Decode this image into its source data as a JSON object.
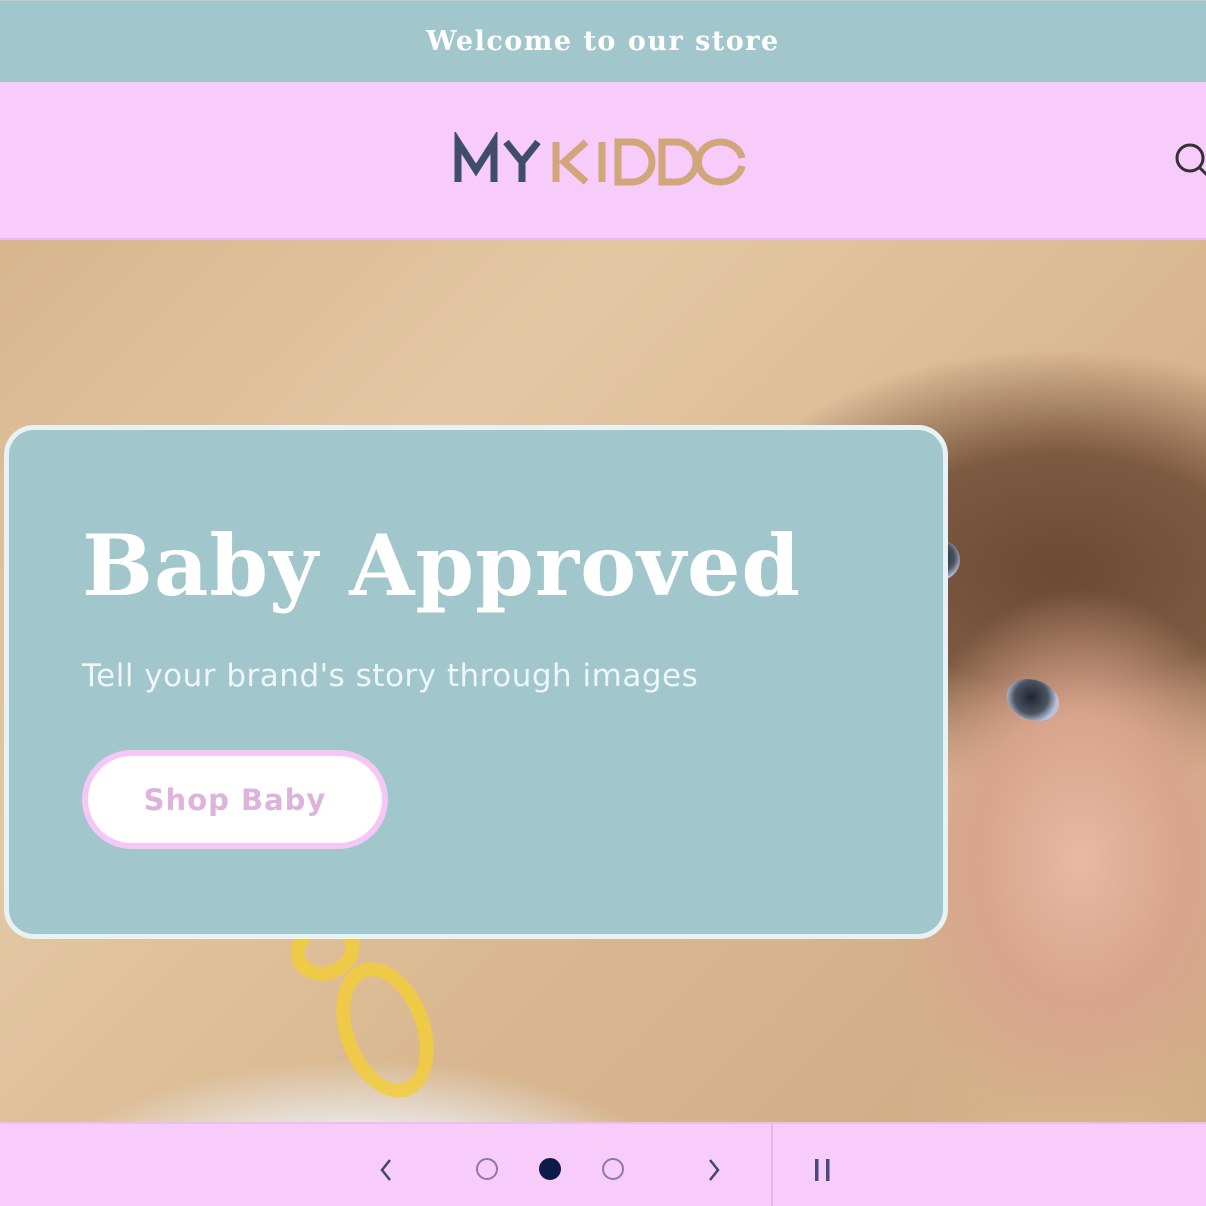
{
  "announcement": {
    "text": "Welcome to our store"
  },
  "header": {
    "logo": {
      "part1": "MY",
      "part2": "KIDDO",
      "part1_color": "#3f4d6b",
      "part2_color": "#d1a67a"
    },
    "search_icon": "search-icon"
  },
  "hero": {
    "slide": {
      "title": "Baby Approved",
      "subtitle": "Tell your brand's story through images",
      "button_label": "Shop Baby"
    }
  },
  "slider": {
    "prev_icon": "chevron-left-icon",
    "next_icon": "chevron-right-icon",
    "pause_icon": "pause-icon",
    "dots": [
      {
        "label": "Slide 1",
        "active": false
      },
      {
        "label": "Slide 2",
        "active": true
      },
      {
        "label": "Slide 3",
        "active": false
      }
    ],
    "current_slide": 2,
    "total_slides": 3
  },
  "colors": {
    "announcement_bg": "#a1c6cb",
    "header_bg": "#f7ccfa",
    "card_bg": "#a1c6cb",
    "button_text": "#ddb3dc",
    "active_dot": "#0d1b4b"
  }
}
